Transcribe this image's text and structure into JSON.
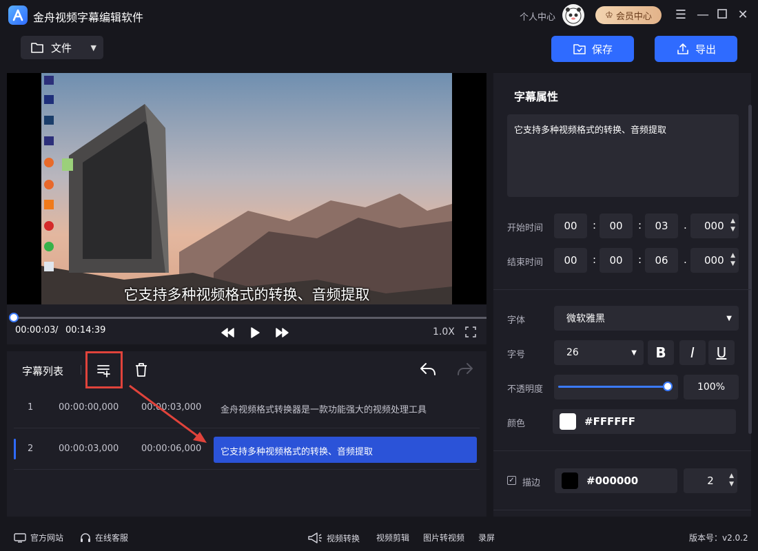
{
  "app": {
    "title": "金舟视频字幕编辑软件",
    "user_center": "个人中心",
    "vip_label": "会员中心"
  },
  "toolbar": {
    "file_label": "文件",
    "save_label": "保存",
    "export_label": "导出"
  },
  "player": {
    "subtitle_overlay": "它支持多种视频格式的转换、音频提取",
    "current_time": "00:00:03",
    "separator": "/",
    "total_time": "00:14:39",
    "speed": "1.0X",
    "progress_fraction": 0.003
  },
  "subtitle_list": {
    "title": "字幕列表",
    "rows": [
      {
        "index": "1",
        "start": "00:00:00,000",
        "end": "00:00:03,000",
        "text": "金舟视频格式转换器是一款功能强大的视频处理工具"
      },
      {
        "index": "2",
        "start": "00:00:03,000",
        "end": "00:00:06,000",
        "text": "它支持多种视频格式的转换、音频提取"
      }
    ]
  },
  "properties": {
    "title": "字幕属性",
    "text_value": "它支持多种视频格式的转换、音频提取",
    "start_label": "开始时间",
    "start": {
      "h": "00",
      "m": "00",
      "s": "03",
      "ms": "000"
    },
    "end_label": "结束时间",
    "end": {
      "h": "00",
      "m": "00",
      "s": "06",
      "ms": "000"
    },
    "colon": ":",
    "dot": ".",
    "font_label": "字体",
    "font_value": "微软雅黑",
    "size_label": "字号",
    "size_value": "26",
    "bold": "B",
    "italic": "I",
    "underline": "U",
    "opacity_label": "不透明度",
    "opacity_value": "100%",
    "color_label": "颜色",
    "color_value": "#FFFFFF",
    "stroke_label": "描边",
    "stroke_color": "#000000",
    "stroke_width": "2"
  },
  "footer": {
    "website": "官方网站",
    "support": "在线客服",
    "video_convert": "视频转换",
    "video_edit": "视频剪辑",
    "img_to_video": "图片转视频",
    "record": "录屏",
    "version": "版本号：v2.0.2"
  },
  "colors": {
    "accent": "#2f6bff",
    "highlight_row": "#2b53d8",
    "annotation_red": "#e0433b"
  }
}
